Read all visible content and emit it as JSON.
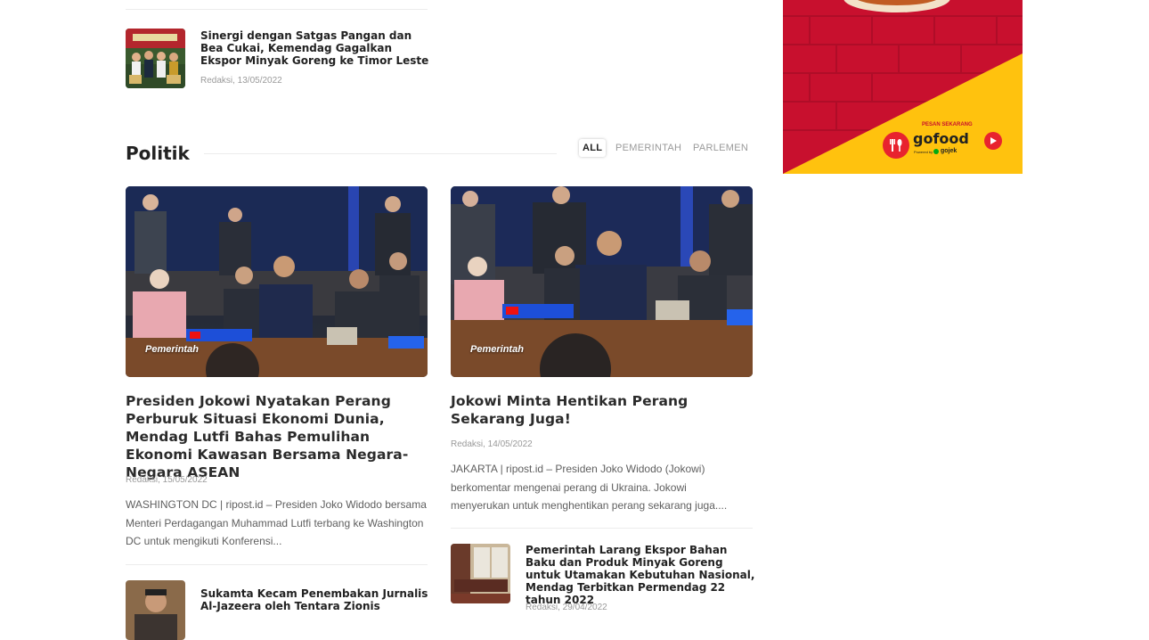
{
  "top_article": {
    "title": "Sinergi dengan Satgas Pangan dan Bea Cukai, Kemendag Gagalkan Ekspor Minyak Goreng ke Timor Leste",
    "meta": "Redaksi, 13/05/2022"
  },
  "section": {
    "title": "Politik",
    "tabs": [
      {
        "label": "ALL",
        "active": true
      },
      {
        "label": "PEMERINTAH",
        "active": false
      },
      {
        "label": "PARLEMEN",
        "active": false
      }
    ]
  },
  "featured": [
    {
      "category": "Pemerintah",
      "title": "Presiden Jokowi Nyatakan Perang Perburuk Situasi Ekonomi Dunia, Mendag Lutfi Bahas Pemulihan Ekonomi Kawasan Bersama Negara-Negara ASEAN",
      "meta": "Redaksi, 15/05/2022",
      "excerpt": "WASHINGTON DC | ripost.id  – Presiden Joko Widodo bersama Menteri Perdagangan Muhammad Lutfi terbang ke Washington DC untuk mengikuti Konferensi..."
    },
    {
      "category": "Pemerintah",
      "title": "Jokowi Minta Hentikan Perang Sekarang Juga!",
      "meta": "Redaksi, 14/05/2022",
      "excerpt": "JAKARTA | ripost.id – Presiden Joko Widodo (Jokowi) berkomentar mengenai perang di Ukraina. Jokowi menyerukan untuk menghentikan perang sekarang juga...."
    }
  ],
  "list_left": [
    {
      "title": "Sukamta Kecam Penembakan Jurnalis Al-Jazeera oleh Tentara Zionis",
      "meta": ""
    }
  ],
  "list_right": [
    {
      "title": "Pemerintah Larang Ekspor Bahan Baku dan Produk Minyak Goreng untuk Utamakan Kebutuhan Nasional, Mendag Terbitkan Permendag 22 tahun 2022",
      "meta": "Redaksi, 29/04/2022"
    }
  ],
  "ad": {
    "cta": "PESAN SEKARANG",
    "brand": "gofood",
    "powered": "Powered by",
    "powered_brand": "gojek",
    "colors": {
      "red": "#c8102e",
      "yellow": "#ffc20e"
    }
  },
  "icons": [
    "gofood-logo-icon",
    "play-icon",
    "gojek-icon"
  ]
}
